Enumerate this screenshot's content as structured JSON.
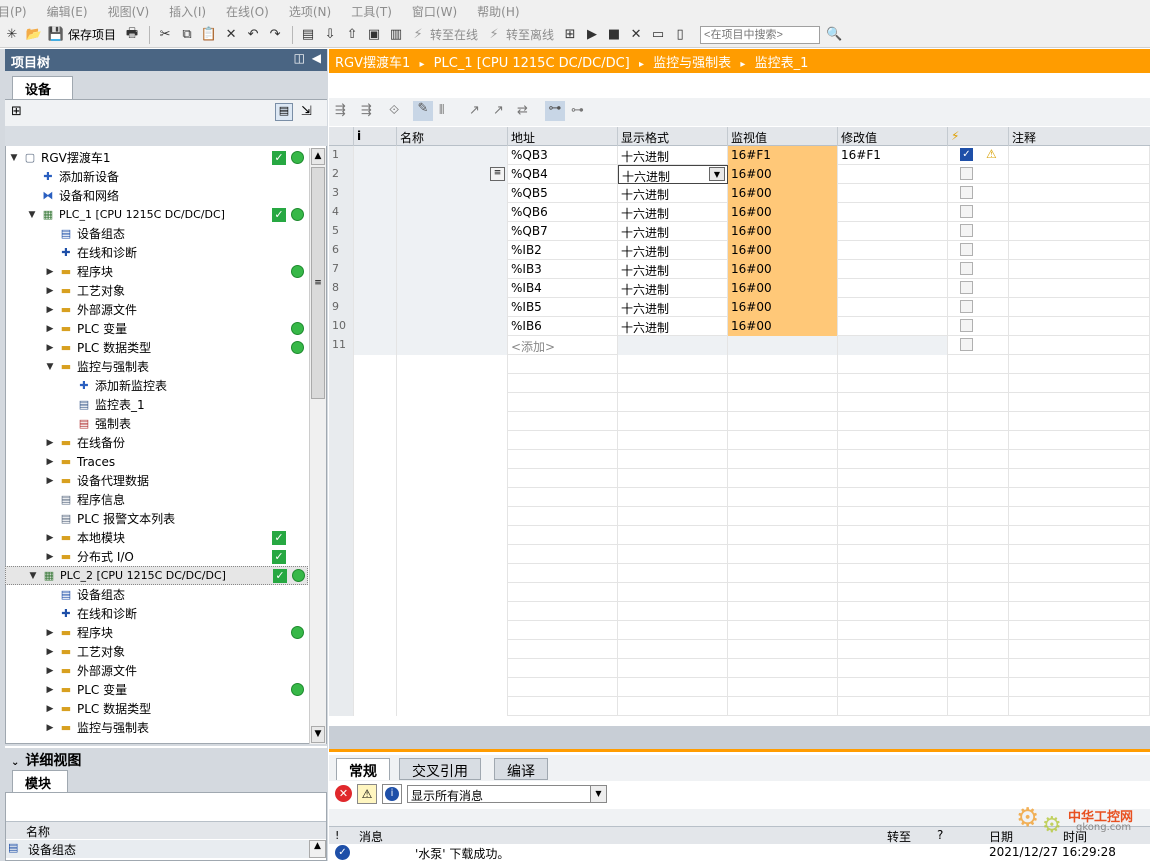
{
  "menu": [
    "目(P)",
    "编辑(E)",
    "视图(V)",
    "插入(I)",
    "在线(O)",
    "选项(N)",
    "工具(T)",
    "窗口(W)",
    "帮助(H)"
  ],
  "toolbar": {
    "save_label": "保存项目",
    "go_online_label": "转至在线",
    "go_offline_label": "转至离线",
    "search_placeholder": "<在项目中搜索>"
  },
  "left_panel": {
    "title": "项目树",
    "tab": "设备",
    "tree": [
      {
        "label": "RGV摆渡车1",
        "level": 0,
        "arrow": "down",
        "icon": "project-icon",
        "check": true,
        "dot": true
      },
      {
        "label": "添加新设备",
        "level": 1,
        "arrow": "",
        "icon": "add-device-icon",
        "check": false,
        "dot": false
      },
      {
        "label": "设备和网络",
        "level": 1,
        "arrow": "",
        "icon": "network-icon",
        "check": false,
        "dot": false
      },
      {
        "label": "PLC_1 [CPU 1215C DC/DC/DC]",
        "level": 1,
        "arrow": "down",
        "icon": "plc-icon",
        "check": true,
        "dot": true,
        "bold": true
      },
      {
        "label": "设备组态",
        "level": 2,
        "arrow": "",
        "icon": "device-config-icon",
        "check": false,
        "dot": false
      },
      {
        "label": "在线和诊断",
        "level": 2,
        "arrow": "",
        "icon": "diagnostics-icon",
        "check": false,
        "dot": false
      },
      {
        "label": "程序块",
        "level": 2,
        "arrow": "right",
        "icon": "folder-icon",
        "check": false,
        "dot": true
      },
      {
        "label": "工艺对象",
        "level": 2,
        "arrow": "right",
        "icon": "folder-icon",
        "check": false,
        "dot": false
      },
      {
        "label": "外部源文件",
        "level": 2,
        "arrow": "right",
        "icon": "folder-icon",
        "check": false,
        "dot": false
      },
      {
        "label": "PLC 变量",
        "level": 2,
        "arrow": "right",
        "icon": "folder-icon",
        "check": false,
        "dot": true
      },
      {
        "label": "PLC 数据类型",
        "level": 2,
        "arrow": "right",
        "icon": "folder-icon",
        "check": false,
        "dot": true
      },
      {
        "label": "监控与强制表",
        "level": 2,
        "arrow": "down",
        "icon": "folder-icon",
        "check": false,
        "dot": false
      },
      {
        "label": "添加新监控表",
        "level": 3,
        "arrow": "",
        "icon": "add-table-icon",
        "check": false,
        "dot": false
      },
      {
        "label": "监控表_1",
        "level": 3,
        "arrow": "",
        "icon": "watch-table-icon",
        "check": false,
        "dot": false
      },
      {
        "label": "强制表",
        "level": 3,
        "arrow": "",
        "icon": "force-table-icon",
        "check": false,
        "dot": false
      },
      {
        "label": "在线备份",
        "level": 2,
        "arrow": "right",
        "icon": "folder-icon",
        "check": false,
        "dot": false
      },
      {
        "label": "Traces",
        "level": 2,
        "arrow": "right",
        "icon": "folder-icon",
        "check": false,
        "dot": false
      },
      {
        "label": "设备代理数据",
        "level": 2,
        "arrow": "right",
        "icon": "folder-icon",
        "check": false,
        "dot": false
      },
      {
        "label": "程序信息",
        "level": 2,
        "arrow": "",
        "icon": "program-info-icon",
        "check": false,
        "dot": false
      },
      {
        "label": "PLC 报警文本列表",
        "level": 2,
        "arrow": "",
        "icon": "alarm-text-icon",
        "check": false,
        "dot": false
      },
      {
        "label": "本地模块",
        "level": 2,
        "arrow": "right",
        "icon": "folder-icon",
        "check": true,
        "dot": false
      },
      {
        "label": "分布式 I/O",
        "level": 2,
        "arrow": "right",
        "icon": "folder-icon",
        "check": true,
        "dot": false
      },
      {
        "label": "PLC_2 [CPU 1215C DC/DC/DC]",
        "level": 1,
        "arrow": "down",
        "icon": "plc-icon",
        "check": true,
        "dot": true,
        "bold": true,
        "selected": true
      },
      {
        "label": "设备组态",
        "level": 2,
        "arrow": "",
        "icon": "device-config-icon",
        "check": false,
        "dot": false
      },
      {
        "label": "在线和诊断",
        "level": 2,
        "arrow": "",
        "icon": "diagnostics-icon",
        "check": false,
        "dot": false
      },
      {
        "label": "程序块",
        "level": 2,
        "arrow": "right",
        "icon": "folder-icon",
        "check": false,
        "dot": true
      },
      {
        "label": "工艺对象",
        "level": 2,
        "arrow": "right",
        "icon": "folder-icon",
        "check": false,
        "dot": false
      },
      {
        "label": "外部源文件",
        "level": 2,
        "arrow": "right",
        "icon": "folder-icon",
        "check": false,
        "dot": false
      },
      {
        "label": "PLC 变量",
        "level": 2,
        "arrow": "right",
        "icon": "folder-icon",
        "check": false,
        "dot": true
      },
      {
        "label": "PLC 数据类型",
        "level": 2,
        "arrow": "right",
        "icon": "folder-icon",
        "check": false,
        "dot": false
      },
      {
        "label": "监控与强制表",
        "level": 2,
        "arrow": "right",
        "icon": "folder-icon",
        "check": false,
        "dot": false
      }
    ],
    "detail_title": "详细视图",
    "detail_tab": "模块",
    "detail_col": "名称",
    "detail_row": "设备组态"
  },
  "breadcrumb": [
    "RGV摆渡车1",
    "PLC_1 [CPU 1215C DC/DC/DC]",
    "监控与强制表",
    "监控表_1"
  ],
  "watch_table": {
    "columns": [
      "i",
      "名称",
      "地址",
      "显示格式",
      "监视值",
      "修改值",
      "⚡",
      "注释"
    ],
    "rows": [
      {
        "n": "1",
        "address": "%QB3",
        "format": "十六进制",
        "monitor": "16#F1",
        "modify": "16#F1",
        "checked": true,
        "warn": true
      },
      {
        "n": "2",
        "address": "%QB4",
        "format": "十六进制",
        "monitor": "16#00",
        "modify": "",
        "checked": false,
        "warn": false,
        "editing": true
      },
      {
        "n": "3",
        "address": "%QB5",
        "format": "十六进制",
        "monitor": "16#00",
        "modify": "",
        "checked": false,
        "warn": false
      },
      {
        "n": "4",
        "address": "%QB6",
        "format": "十六进制",
        "monitor": "16#00",
        "modify": "",
        "checked": false,
        "warn": false
      },
      {
        "n": "5",
        "address": "%QB7",
        "format": "十六进制",
        "monitor": "16#00",
        "modify": "",
        "checked": false,
        "warn": false
      },
      {
        "n": "6",
        "address": "%IB2",
        "format": "十六进制",
        "monitor": "16#00",
        "modify": "",
        "checked": false,
        "warn": false
      },
      {
        "n": "7",
        "address": "%IB3",
        "format": "十六进制",
        "monitor": "16#00",
        "modify": "",
        "checked": false,
        "warn": false
      },
      {
        "n": "8",
        "address": "%IB4",
        "format": "十六进制",
        "monitor": "16#00",
        "modify": "",
        "checked": false,
        "warn": false
      },
      {
        "n": "9",
        "address": "%IB5",
        "format": "十六进制",
        "monitor": "16#00",
        "modify": "",
        "checked": false,
        "warn": false
      },
      {
        "n": "10",
        "address": "%IB6",
        "format": "十六进制",
        "monitor": "16#00",
        "modify": "",
        "checked": false,
        "warn": false
      },
      {
        "n": "11",
        "address": "<添加>",
        "format": "",
        "monitor": "",
        "modify": "",
        "checked": false,
        "warn": false,
        "add": true
      }
    ],
    "monitor_color": "#ffc878"
  },
  "inspector": {
    "tabs": [
      "常规",
      "交叉引用",
      "编译"
    ],
    "filter": "显示所有消息",
    "msg_cols": [
      "!",
      "消息",
      "转至",
      "?",
      "日期",
      "时间"
    ],
    "msg": {
      "text": "'水泵' 下载成功。",
      "date": "2021/12/27",
      "time": "16:29:28"
    }
  },
  "watermark": {
    "name": "中华工控网",
    "url": "gkong.com"
  },
  "colors": {
    "accent_orange": "#ff9c00",
    "panel_title": "#4a6583",
    "ok_green": "#27a842"
  }
}
